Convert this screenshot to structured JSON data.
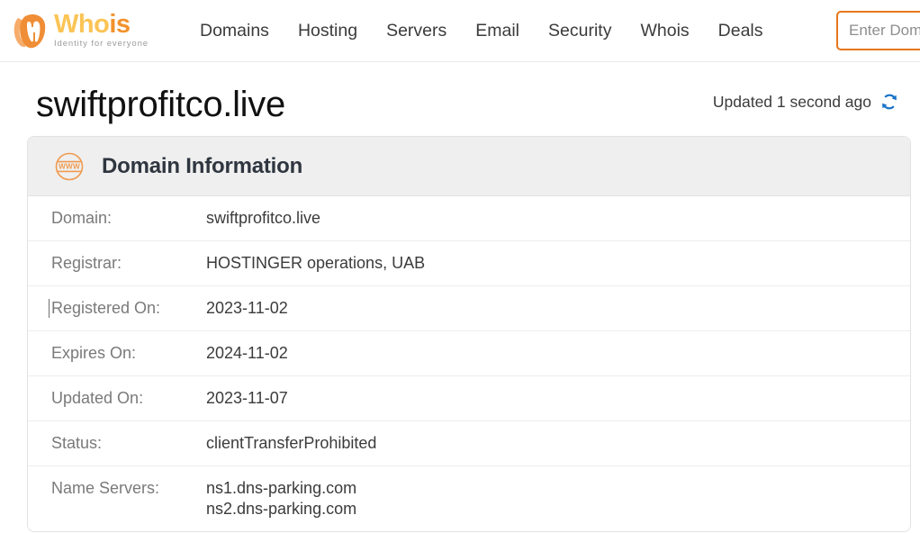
{
  "header": {
    "logo": {
      "mark_icon": "whois-fingerprint-icon",
      "word_part1": "Who",
      "word_part2": "is",
      "tagline": "Identity for everyone",
      "color_light": "#fbc455",
      "color_dark": "#f2922c"
    },
    "nav": [
      {
        "label": "Domains"
      },
      {
        "label": "Hosting"
      },
      {
        "label": "Servers"
      },
      {
        "label": "Email"
      },
      {
        "label": "Security"
      },
      {
        "label": "Whois"
      },
      {
        "label": "Deals"
      }
    ],
    "search": {
      "placeholder": "Enter Domain Name",
      "value": "",
      "border_color": "#e8761a"
    }
  },
  "page": {
    "title": "swiftprofitco.live",
    "updated_text": "Updated 1 second ago",
    "refresh_icon": "refresh-icon",
    "refresh_color": "#1a73c8"
  },
  "card": {
    "icon": "www-globe-icon",
    "icon_color": "#ef9b52",
    "title": "Domain Information",
    "rows": [
      {
        "label": "Domain:",
        "value": "swiftprofitco.live"
      },
      {
        "label": "Registrar:",
        "value": "HOSTINGER operations, UAB"
      },
      {
        "label": "Registered On:",
        "value": "2023-11-02"
      },
      {
        "label": "Expires On:",
        "value": "2024-11-02"
      },
      {
        "label": "Updated On:",
        "value": "2023-11-07"
      },
      {
        "label": "Status:",
        "value": "clientTransferProhibited"
      },
      {
        "label": "Name Servers:",
        "value": "ns1.dns-parking.com\nns2.dns-parking.com"
      }
    ]
  }
}
